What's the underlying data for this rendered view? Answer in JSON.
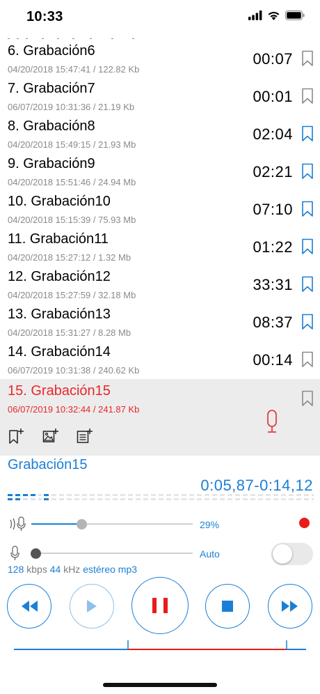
{
  "status_bar": {
    "time": "10:33"
  },
  "recordings": [
    {
      "title": "6. Grabación6",
      "meta": "04/20/2018 15:47:41 / 122.82 Kb",
      "duration": "00:07",
      "bookmark_color": "#8a8a8a"
    },
    {
      "title": "7. Grabación7",
      "meta": "06/07/2019 10:31:36 / 21.19 Kb",
      "duration": "00:01",
      "bookmark_color": "#8a8a8a"
    },
    {
      "title": "8. Grabación8",
      "meta": "04/20/2018 15:49:15 / 21.93 Mb",
      "duration": "02:04",
      "bookmark_color": "#1a7fd6"
    },
    {
      "title": "9. Grabación9",
      "meta": "04/20/2018 15:51:46 / 24.94 Mb",
      "duration": "02:21",
      "bookmark_color": "#1a7fd6"
    },
    {
      "title": "10. Grabación10",
      "meta": "04/20/2018 15:15:39 / 75.93 Mb",
      "duration": "07:10",
      "bookmark_color": "#1a7fd6"
    },
    {
      "title": "11. Grabación11",
      "meta": "04/20/2018 15:27:12 / 1.32 Mb",
      "duration": "01:22",
      "bookmark_color": "#1a7fd6"
    },
    {
      "title": "12. Grabación12",
      "meta": "04/20/2018 15:27:59 / 32.18 Mb",
      "duration": "33:31",
      "bookmark_color": "#1a7fd6"
    },
    {
      "title": "13. Grabación13",
      "meta": "04/20/2018 15:31:27 / 8.28 Mb",
      "duration": "08:37",
      "bookmark_color": "#1a7fd6"
    },
    {
      "title": "14. Grabación14",
      "meta": "06/07/2019 10:31:38 / 240.62 Kb",
      "duration": "00:14",
      "bookmark_color": "#8a8a8a"
    }
  ],
  "selected": {
    "title": "15. Grabación15",
    "meta": "06/07/2019 10:32:44 / 241.87 Kb",
    "actions": [
      "add-bookmark-icon",
      "add-image-icon",
      "add-note-icon"
    ]
  },
  "player": {
    "name": "Grabación15",
    "time": "0:05,87-0:14,12",
    "volume_percent": 29,
    "volume_label": "29%",
    "mic_gain_label": "Auto",
    "auto_gain_toggle": false,
    "bitrate_value": "128",
    "bitrate_unit": "kbps",
    "samplerate_value": "44",
    "samplerate_unit": "kHz",
    "channels": "estéreo",
    "format": "mp3",
    "progress": 0.59
  },
  "colors": {
    "accent": "#1a7fd6",
    "recording": "#e8262b"
  }
}
